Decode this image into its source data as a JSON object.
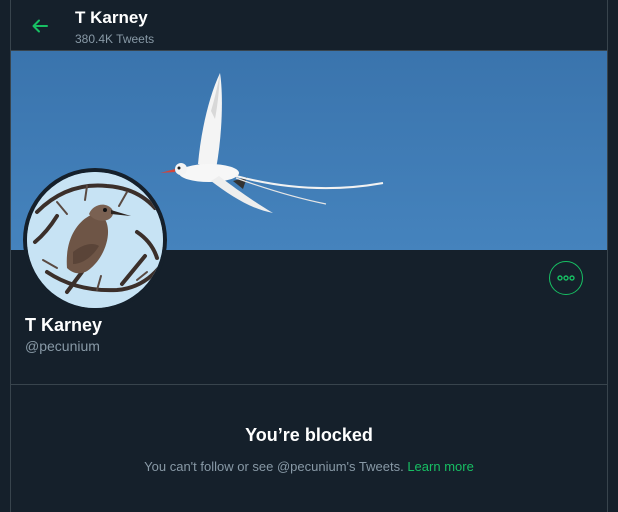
{
  "colors": {
    "background": "#15202b",
    "border": "#38444d",
    "accent": "#17bf63",
    "text_primary": "#ffffff",
    "text_secondary": "#8899a6",
    "banner_sky": "#3d7ab3"
  },
  "header": {
    "back_icon": "arrow-left-icon",
    "name": "T Karney",
    "tweet_count": "380.4K Tweets"
  },
  "banner": {
    "image": "tropicbird-in-flight-photo"
  },
  "avatar": {
    "image": "bird-on-branches-photo"
  },
  "actions": {
    "more_icon": "more-options-icon"
  },
  "profile": {
    "name": "T Karney",
    "handle": "@pecunium"
  },
  "blocked": {
    "title": "You’re blocked",
    "message": "You can't follow or see @pecunium's Tweets.",
    "learn_more": "Learn more"
  }
}
